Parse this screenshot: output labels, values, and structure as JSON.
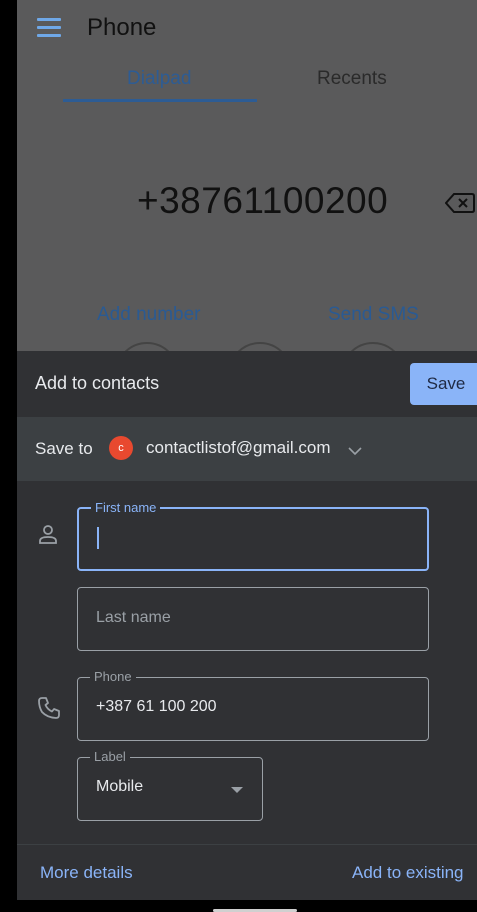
{
  "phone_app": {
    "title": "Phone",
    "tabs": [
      {
        "label": "Dialpad",
        "active": true
      },
      {
        "label": "Recents",
        "active": false
      }
    ],
    "dialed_number": "+38761100200",
    "add_number_label": "Add number",
    "send_sms_label": "Send SMS",
    "icons": {
      "menu": "menu-icon",
      "backspace": "backspace-icon"
    }
  },
  "sheet": {
    "title": "Add to contacts",
    "save_label": "Save",
    "save_to_label": "Save to",
    "account_initial": "c",
    "account_email": "contactlistof@gmail.com",
    "first_name": {
      "legend": "First name",
      "value": ""
    },
    "last_name": {
      "placeholder": "Last name",
      "value": ""
    },
    "phone": {
      "legend": "Phone",
      "value": "+387 61 100 200"
    },
    "label": {
      "legend": "Label",
      "value": "Mobile"
    },
    "more_details_label": "More details",
    "add_to_existing_label": "Add to existing",
    "icons": {
      "person": "person-icon",
      "phone": "phone-icon",
      "chevron": "chevron-down-icon",
      "dropdown": "dropdown-arrow-icon"
    }
  },
  "colors": {
    "accent": "#8ab4f8",
    "sheet_bg": "#303134",
    "save_row_bg": "#3c4043",
    "dim_bg": "#5a5a5b",
    "avatar": "#e8492f",
    "tab_active": "#2d5c94"
  }
}
